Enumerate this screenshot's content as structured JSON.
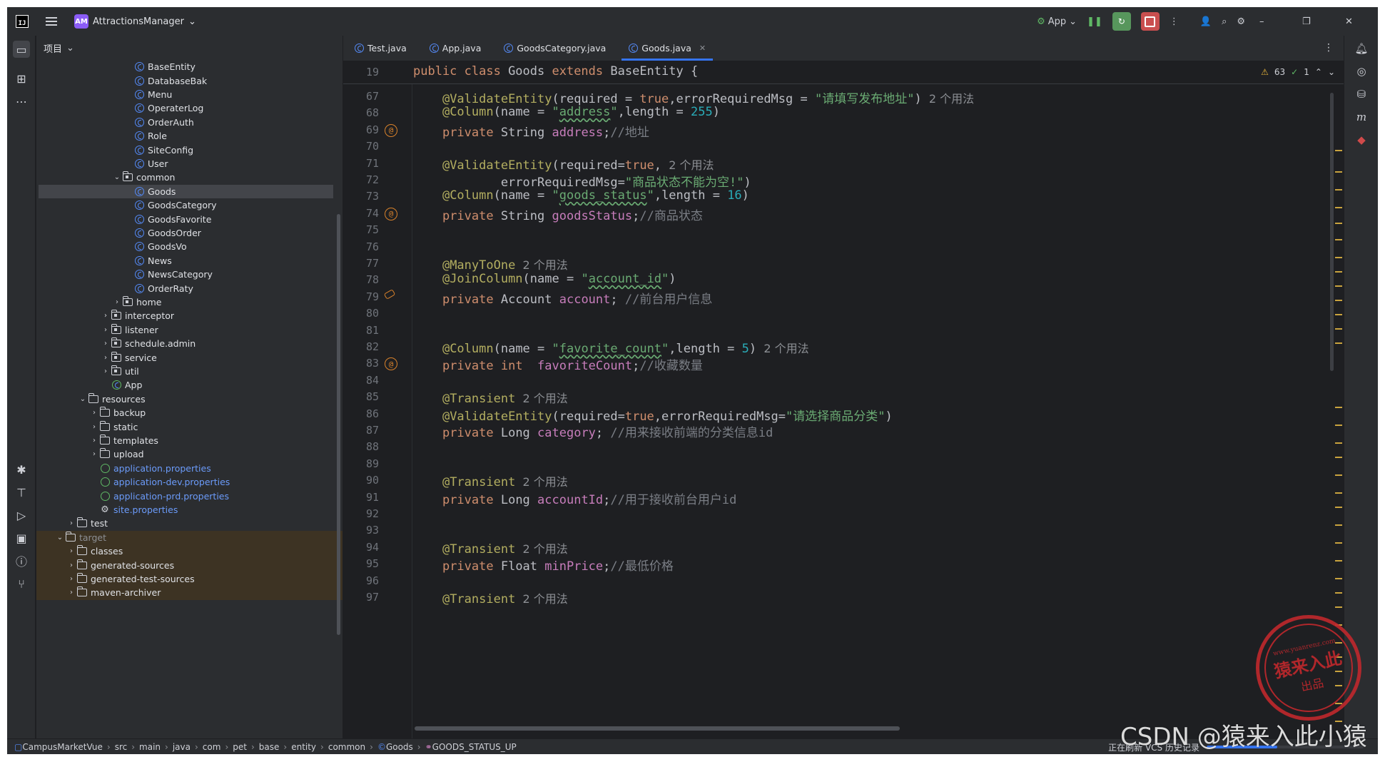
{
  "titlebar": {
    "project_badge": "AM",
    "project_name": "AttractionsManager",
    "run_config": "App"
  },
  "project_panel": {
    "header": "项目",
    "items": [
      {
        "label": "BaseEntity",
        "kind": "class",
        "depth": 8
      },
      {
        "label": "DatabaseBak",
        "kind": "class",
        "depth": 8
      },
      {
        "label": "Menu",
        "kind": "class",
        "depth": 8
      },
      {
        "label": "OperaterLog",
        "kind": "class",
        "depth": 8
      },
      {
        "label": "OrderAuth",
        "kind": "class",
        "depth": 8
      },
      {
        "label": "Role",
        "kind": "class",
        "depth": 8
      },
      {
        "label": "SiteConfig",
        "kind": "class",
        "depth": 8
      },
      {
        "label": "User",
        "kind": "class",
        "depth": 8
      },
      {
        "label": "common",
        "kind": "package",
        "depth": 7,
        "expanded": true
      },
      {
        "label": "Goods",
        "kind": "class",
        "depth": 8,
        "selected": true
      },
      {
        "label": "GoodsCategory",
        "kind": "class",
        "depth": 8
      },
      {
        "label": "GoodsFavorite",
        "kind": "class",
        "depth": 8
      },
      {
        "label": "GoodsOrder",
        "kind": "class",
        "depth": 8
      },
      {
        "label": "GoodsVo",
        "kind": "class",
        "depth": 8
      },
      {
        "label": "News",
        "kind": "class",
        "depth": 8
      },
      {
        "label": "NewsCategory",
        "kind": "class",
        "depth": 8
      },
      {
        "label": "OrderRaty",
        "kind": "class",
        "depth": 8
      },
      {
        "label": "home",
        "kind": "package",
        "depth": 7,
        "expanded": false
      },
      {
        "label": "interceptor",
        "kind": "package",
        "depth": 6,
        "expanded": false
      },
      {
        "label": "listener",
        "kind": "package",
        "depth": 6,
        "expanded": false
      },
      {
        "label": "schedule.admin",
        "kind": "package",
        "depth": 6,
        "expanded": false
      },
      {
        "label": "service",
        "kind": "package",
        "depth": 6,
        "expanded": false
      },
      {
        "label": "util",
        "kind": "package",
        "depth": 6,
        "expanded": false
      },
      {
        "label": "App",
        "kind": "app",
        "depth": 6
      },
      {
        "label": "resources",
        "kind": "folder",
        "depth": 4,
        "expanded": true
      },
      {
        "label": "backup",
        "kind": "folder",
        "depth": 5,
        "expanded": false
      },
      {
        "label": "static",
        "kind": "folder",
        "depth": 5,
        "expanded": false
      },
      {
        "label": "templates",
        "kind": "folder",
        "depth": 5,
        "expanded": false
      },
      {
        "label": "upload",
        "kind": "folder",
        "depth": 5,
        "expanded": false
      },
      {
        "label": "application.properties",
        "kind": "props",
        "depth": 5
      },
      {
        "label": "application-dev.properties",
        "kind": "props",
        "depth": 5
      },
      {
        "label": "application-prd.properties",
        "kind": "props",
        "depth": 5
      },
      {
        "label": "site.properties",
        "kind": "settings",
        "depth": 5
      },
      {
        "label": "test",
        "kind": "folder",
        "depth": 3,
        "expanded": false
      },
      {
        "label": "target",
        "kind": "folder-excluded",
        "depth": 2,
        "expanded": true
      },
      {
        "label": "classes",
        "kind": "folder",
        "depth": 3,
        "expanded": false,
        "excluded": true
      },
      {
        "label": "generated-sources",
        "kind": "folder",
        "depth": 3,
        "expanded": false,
        "excluded": true
      },
      {
        "label": "generated-test-sources",
        "kind": "folder",
        "depth": 3,
        "expanded": false,
        "excluded": true
      },
      {
        "label": "maven-archiver",
        "kind": "folder",
        "depth": 3,
        "expanded": false,
        "excluded": true
      }
    ]
  },
  "editor": {
    "tabs": [
      {
        "label": "Test.java",
        "active": false
      },
      {
        "label": "App.java",
        "active": false
      },
      {
        "label": "GoodsCategory.java",
        "active": false
      },
      {
        "label": "Goods.java",
        "active": true
      }
    ],
    "inspections": {
      "warnings": "63",
      "ok": "1"
    },
    "sticky_line": "19",
    "sticky_code": [
      {
        "t": "public class ",
        "c": "kw"
      },
      {
        "t": "Goods ",
        "c": ""
      },
      {
        "t": "extends ",
        "c": "kw"
      },
      {
        "t": "BaseEntity {",
        "c": ""
      }
    ],
    "lines": [
      {
        "n": "67",
        "tokens": [
          {
            "t": "    ",
            "c": ""
          },
          {
            "t": "@ValidateEntity",
            "c": "ann"
          },
          {
            "t": "(required = ",
            "c": ""
          },
          {
            "t": "true",
            "c": "kw"
          },
          {
            "t": ",errorRequiredMsg = ",
            "c": ""
          },
          {
            "t": "\"请填写发布地址\"",
            "c": "str"
          },
          {
            "t": ")",
            "c": ""
          },
          {
            "t": "  2 个用法",
            "c": "hint"
          }
        ]
      },
      {
        "n": "68",
        "tokens": [
          {
            "t": "    ",
            "c": ""
          },
          {
            "t": "@Column",
            "c": "ann"
          },
          {
            "t": "(name = ",
            "c": ""
          },
          {
            "t": "\"",
            "c": "str"
          },
          {
            "t": "address",
            "c": "str und"
          },
          {
            "t": "\"",
            "c": "str"
          },
          {
            "t": ",length = ",
            "c": ""
          },
          {
            "t": "255",
            "c": "num"
          },
          {
            "t": ")",
            "c": ""
          }
        ]
      },
      {
        "n": "69",
        "mark": "at",
        "tokens": [
          {
            "t": "    ",
            "c": ""
          },
          {
            "t": "private ",
            "c": "kw"
          },
          {
            "t": "String ",
            "c": ""
          },
          {
            "t": "address",
            "c": "fld"
          },
          {
            "t": ";",
            "c": ""
          },
          {
            "t": "//地址",
            "c": "cmt"
          }
        ]
      },
      {
        "n": "70",
        "tokens": []
      },
      {
        "n": "71",
        "tokens": [
          {
            "t": "    ",
            "c": ""
          },
          {
            "t": "@ValidateEntity",
            "c": "ann"
          },
          {
            "t": "(required=",
            "c": ""
          },
          {
            "t": "true",
            "c": "kw"
          },
          {
            "t": ",",
            "c": ""
          },
          {
            "t": "  2 个用法",
            "c": "hint"
          }
        ]
      },
      {
        "n": "72",
        "tokens": [
          {
            "t": "            errorRequiredMsg=",
            "c": ""
          },
          {
            "t": "\"商品状态不能为空!\"",
            "c": "str"
          },
          {
            "t": ")",
            "c": ""
          }
        ]
      },
      {
        "n": "73",
        "tokens": [
          {
            "t": "    ",
            "c": ""
          },
          {
            "t": "@Column",
            "c": "ann"
          },
          {
            "t": "(name = ",
            "c": ""
          },
          {
            "t": "\"",
            "c": "str"
          },
          {
            "t": "goods_status",
            "c": "str und"
          },
          {
            "t": "\"",
            "c": "str"
          },
          {
            "t": ",length = ",
            "c": ""
          },
          {
            "t": "16",
            "c": "num"
          },
          {
            "t": ")",
            "c": ""
          }
        ]
      },
      {
        "n": "74",
        "mark": "at",
        "tokens": [
          {
            "t": "    ",
            "c": ""
          },
          {
            "t": "private ",
            "c": "kw"
          },
          {
            "t": "String ",
            "c": ""
          },
          {
            "t": "goodsStatus",
            "c": "fld"
          },
          {
            "t": ";",
            "c": ""
          },
          {
            "t": "//商品状态",
            "c": "cmt"
          }
        ]
      },
      {
        "n": "75",
        "tokens": []
      },
      {
        "n": "76",
        "tokens": []
      },
      {
        "n": "77",
        "tokens": [
          {
            "t": "    ",
            "c": ""
          },
          {
            "t": "@ManyToOne",
            "c": "ann"
          },
          {
            "t": "  2 个用法",
            "c": "hint"
          }
        ]
      },
      {
        "n": "78",
        "tokens": [
          {
            "t": "    ",
            "c": ""
          },
          {
            "t": "@JoinColumn",
            "c": "ann"
          },
          {
            "t": "(name = ",
            "c": ""
          },
          {
            "t": "\"",
            "c": "str"
          },
          {
            "t": "account_id",
            "c": "str und"
          },
          {
            "t": "\"",
            "c": "str"
          },
          {
            "t": ")",
            "c": ""
          }
        ]
      },
      {
        "n": "79",
        "mark": "link",
        "tokens": [
          {
            "t": "    ",
            "c": ""
          },
          {
            "t": "private ",
            "c": "kw"
          },
          {
            "t": "Account ",
            "c": ""
          },
          {
            "t": "account",
            "c": "fld"
          },
          {
            "t": "; ",
            "c": ""
          },
          {
            "t": "//前台用户信息",
            "c": "cmt"
          }
        ]
      },
      {
        "n": "80",
        "tokens": []
      },
      {
        "n": "81",
        "tokens": []
      },
      {
        "n": "82",
        "tokens": [
          {
            "t": "    ",
            "c": ""
          },
          {
            "t": "@Column",
            "c": "ann"
          },
          {
            "t": "(name = ",
            "c": ""
          },
          {
            "t": "\"",
            "c": "str"
          },
          {
            "t": "favorite_count",
            "c": "str und"
          },
          {
            "t": "\"",
            "c": "str"
          },
          {
            "t": ",length = ",
            "c": ""
          },
          {
            "t": "5",
            "c": "num"
          },
          {
            "t": ")",
            "c": ""
          },
          {
            "t": "  2 个用法",
            "c": "hint"
          }
        ]
      },
      {
        "n": "83",
        "mark": "at",
        "tokens": [
          {
            "t": "    ",
            "c": ""
          },
          {
            "t": "private ",
            "c": "kw"
          },
          {
            "t": "int  ",
            "c": "kw"
          },
          {
            "t": "favoriteCount",
            "c": "fld"
          },
          {
            "t": ";",
            "c": ""
          },
          {
            "t": "//收藏数量",
            "c": "cmt"
          }
        ]
      },
      {
        "n": "84",
        "tokens": []
      },
      {
        "n": "85",
        "tokens": [
          {
            "t": "    ",
            "c": ""
          },
          {
            "t": "@Transient",
            "c": "ann"
          },
          {
            "t": "  2 个用法",
            "c": "hint"
          }
        ]
      },
      {
        "n": "86",
        "tokens": [
          {
            "t": "    ",
            "c": ""
          },
          {
            "t": "@ValidateEntity",
            "c": "ann"
          },
          {
            "t": "(required=",
            "c": ""
          },
          {
            "t": "true",
            "c": "kw"
          },
          {
            "t": ",errorRequiredMsg=",
            "c": ""
          },
          {
            "t": "\"请选择商品分类\"",
            "c": "str"
          },
          {
            "t": ")",
            "c": ""
          }
        ]
      },
      {
        "n": "87",
        "tokens": [
          {
            "t": "    ",
            "c": ""
          },
          {
            "t": "private ",
            "c": "kw"
          },
          {
            "t": "Long ",
            "c": ""
          },
          {
            "t": "category",
            "c": "fld"
          },
          {
            "t": "; ",
            "c": ""
          },
          {
            "t": "//用来接收前端的分类信息id",
            "c": "cmt"
          }
        ]
      },
      {
        "n": "88",
        "tokens": []
      },
      {
        "n": "89",
        "tokens": []
      },
      {
        "n": "90",
        "tokens": [
          {
            "t": "    ",
            "c": ""
          },
          {
            "t": "@Transient",
            "c": "ann"
          },
          {
            "t": "  2 个用法",
            "c": "hint"
          }
        ]
      },
      {
        "n": "91",
        "tokens": [
          {
            "t": "    ",
            "c": ""
          },
          {
            "t": "private ",
            "c": "kw"
          },
          {
            "t": "Long ",
            "c": ""
          },
          {
            "t": "accountId",
            "c": "fld"
          },
          {
            "t": ";",
            "c": ""
          },
          {
            "t": "//用于接收前台用户id",
            "c": "cmt"
          }
        ]
      },
      {
        "n": "92",
        "tokens": []
      },
      {
        "n": "93",
        "tokens": []
      },
      {
        "n": "94",
        "tokens": [
          {
            "t": "    ",
            "c": ""
          },
          {
            "t": "@Transient",
            "c": "ann"
          },
          {
            "t": "  2 个用法",
            "c": "hint"
          }
        ]
      },
      {
        "n": "95",
        "tokens": [
          {
            "t": "    ",
            "c": ""
          },
          {
            "t": "private ",
            "c": "kw"
          },
          {
            "t": "Float ",
            "c": ""
          },
          {
            "t": "minPrice",
            "c": "fld"
          },
          {
            "t": ";",
            "c": ""
          },
          {
            "t": "//最低价格",
            "c": "cmt"
          }
        ]
      },
      {
        "n": "96",
        "tokens": []
      },
      {
        "n": "97",
        "tokens": [
          {
            "t": "    ",
            "c": ""
          },
          {
            "t": "@Transient",
            "c": "ann"
          },
          {
            "t": "  2 个用法",
            "c": "hint"
          }
        ]
      }
    ]
  },
  "statusbar": {
    "breadcrumbs": [
      "CampusMarketVue",
      "src",
      "main",
      "java",
      "com",
      "pet",
      "base",
      "entity",
      "common",
      "Goods",
      "GOODS_STATUS_UP"
    ],
    "task": "正在刷新 VCS 历史记录",
    "progress": 0.45
  },
  "watermark": {
    "seal_url": "www.yuanrenz.com",
    "seal_main": "猿来入此",
    "seal_sub": "出品",
    "text": "CSDN @猿来入此小猿"
  }
}
